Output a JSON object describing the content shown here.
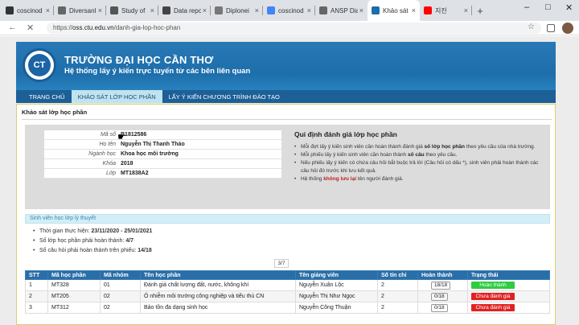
{
  "browser": {
    "tabs": [
      {
        "label": "coscinod",
        "fav": "#333"
      },
      {
        "label": "Diversanl",
        "fav": "#666"
      },
      {
        "label": "Study of",
        "fav": "#555"
      },
      {
        "label": "Data repo",
        "fav": "#444"
      },
      {
        "label": "Diplonei",
        "fav": "#777"
      },
      {
        "label": "coscinod",
        "fav": "#4285f4"
      },
      {
        "label": "ANSP Dia",
        "fav": "#666"
      },
      {
        "label": "Khảo sát",
        "fav": "#1d6eaa"
      },
      {
        "label": "지진",
        "fav": "#ff0000"
      }
    ],
    "new_tab": "+",
    "url_prefix": "https://",
    "url_domain": "oss.ctu.edu.vn",
    "url_path": "/danh-gia-lop-hoc-phan"
  },
  "header": {
    "university": "TRƯỜNG ĐẠI HỌC CẦN THƠ",
    "subtitle": "Hệ thống lấy ý kiến trực tuyến từ các bên liên quan"
  },
  "menu": [
    "TRANG CHỦ",
    "KHẢO SÁT LỚP HỌC PHẦN",
    "LẤY Ý KIẾN CHƯƠNG TRÌNH ĐÀO TẠO"
  ],
  "section_title": "Khảo sát lớp học phần",
  "student": {
    "rows": [
      {
        "k": "Mã số",
        "v": "B1812586"
      },
      {
        "k": "Họ tên",
        "v": "Nguyễn Thị Thanh Thảo"
      },
      {
        "k": "Ngành học",
        "v": "Khoa học môi trường"
      },
      {
        "k": "Khóa",
        "v": "2018"
      },
      {
        "k": "Lớp",
        "v": "MT1838A2"
      }
    ]
  },
  "rules": {
    "title": "Qui định đánh giá lớp học phần",
    "r1a": "Mỗi đợt lấy ý kiến sinh viên cần hoàn thành đánh giá ",
    "r1b": "số lớp học phần",
    "r1c": " theo yêu cầu của nhà trường.",
    "r2a": "Mỗi phiếu lấy ý kiến sinh viên cần hoàn thành ",
    "r2b": "số câu",
    "r2c": " theo yêu cầu.",
    "r3": "Nếu phiếu lấy ý kiến có chứa câu hỏi bắt buộc trả lời (Câu hỏi có dấu *), sinh viên phải hoàn thành các câu hỏi đó trước khi lưu kết quả.",
    "r4a": "Hệ thống ",
    "r4b": "không lưu lại",
    "r4c": " tên người đánh giá."
  },
  "progress_header": "Sinh viên học lớp lý thuyết",
  "stats": {
    "time_label": "Thời gian thực hiện: ",
    "time_value": "23/11/2020 - 25/01/2021",
    "classes_label": "Số lớp học phần phải hoàn thành: ",
    "classes_value": "4/7",
    "questions_label": "Số câu hỏi phải hoàn thành trên phiếu: ",
    "questions_value": "14/18"
  },
  "pager": "3/7",
  "table": {
    "headers": [
      "STT",
      "Mã học phần",
      "Mã nhóm",
      "Tên học phần",
      "Tên giảng viên",
      "Số tín chỉ",
      "Hoàn thành",
      "Trạng thái"
    ],
    "rows": [
      {
        "stt": "1",
        "ma": "MT328",
        "nhom": "01",
        "ten": "Đánh giá chất lượng đất, nước, không khí",
        "gv": "Nguyễn Xuân Lộc",
        "tc": "2",
        "ht": "18/18",
        "tt": "Hoàn thành",
        "done": true
      },
      {
        "stt": "2",
        "ma": "MT205",
        "nhom": "02",
        "ten": "Ô nhiễm môi trường công nghiệp và tiểu thủ CN",
        "gv": "Nguyễn Thị Như Ngọc",
        "tc": "2",
        "ht": "0/18",
        "tt": "Chưa đánh giá",
        "done": false
      },
      {
        "stt": "3",
        "ma": "MT312",
        "nhom": "02",
        "ten": "Bảo tồn đa dạng sinh học",
        "gv": "Nguyễn Công Thuận",
        "tc": "2",
        "ht": "0/18",
        "tt": "Chưa đánh giá",
        "done": false
      }
    ]
  }
}
